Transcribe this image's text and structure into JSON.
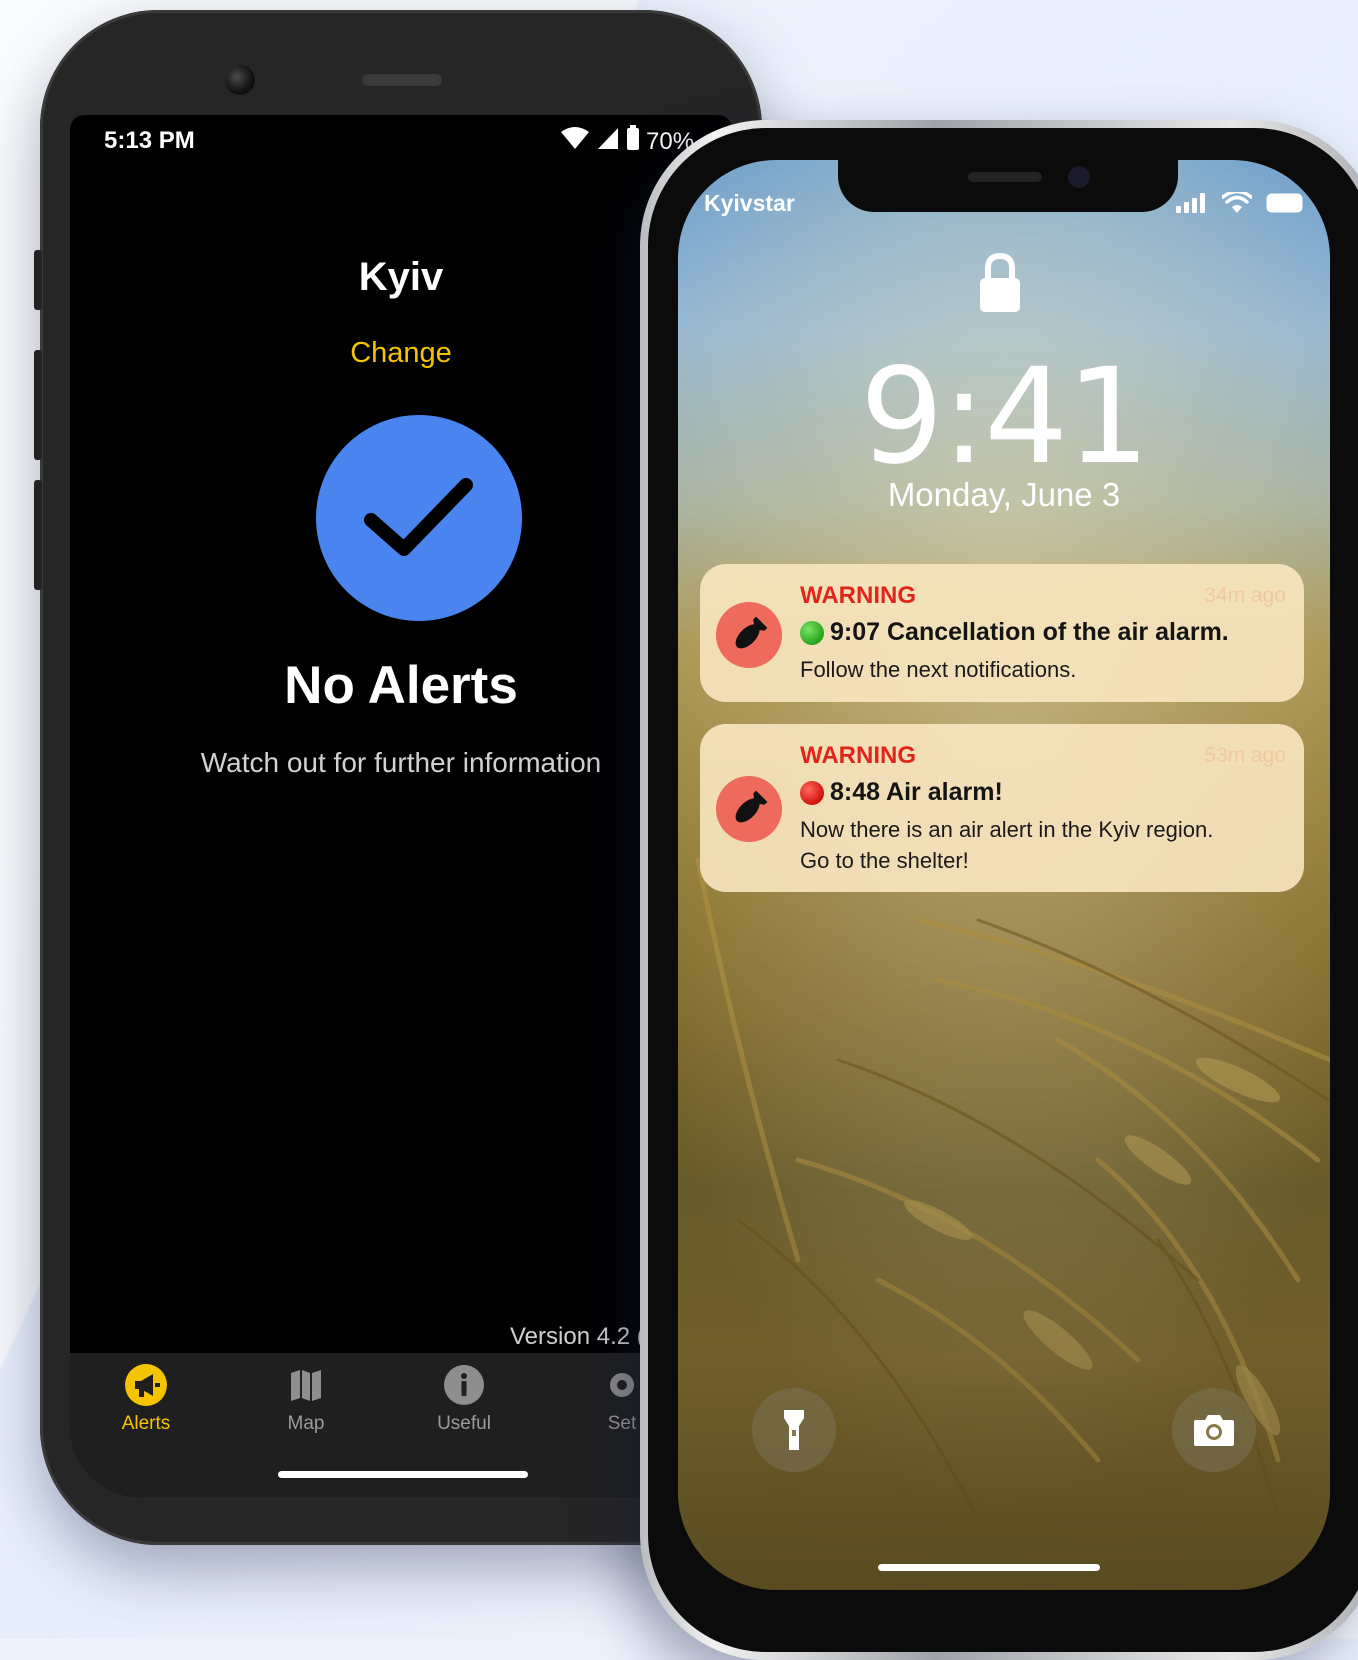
{
  "android": {
    "status_time": "5:13 PM",
    "battery": "70%",
    "city": "Kyiv",
    "change_label": "Change",
    "headline": "No Alerts",
    "subtitle": "Watch out for further information",
    "version": "Version 4.2 (Bui",
    "tabs": [
      {
        "label": "Alerts",
        "icon": "megaphone-icon",
        "active": true
      },
      {
        "label": "Map",
        "icon": "map-icon",
        "active": false
      },
      {
        "label": "Useful",
        "icon": "info-icon",
        "active": false
      },
      {
        "label": "Set",
        "icon": "settings-icon",
        "active": false
      }
    ],
    "colors": {
      "accent": "#f5c400",
      "check_circle": "#4a84ee"
    }
  },
  "iphone": {
    "carrier": "Kyivstar",
    "time": "9:41",
    "date": "Monday, June 3",
    "notifications": [
      {
        "header": "WARNING",
        "time_ago": "34m ago",
        "status": "green",
        "title": "9:07 Cancellation of the air alarm.",
        "body": [
          "Follow the next notifications."
        ]
      },
      {
        "header": "WARNING",
        "time_ago": "53m ago",
        "status": "red",
        "title": "8:48 Air alarm!",
        "body": [
          "Now there is an air alert in the Kyiv region.",
          "Go to the shelter!"
        ]
      }
    ],
    "colors": {
      "warning": "#e1251b",
      "avatar": "#ee6a5c"
    }
  }
}
